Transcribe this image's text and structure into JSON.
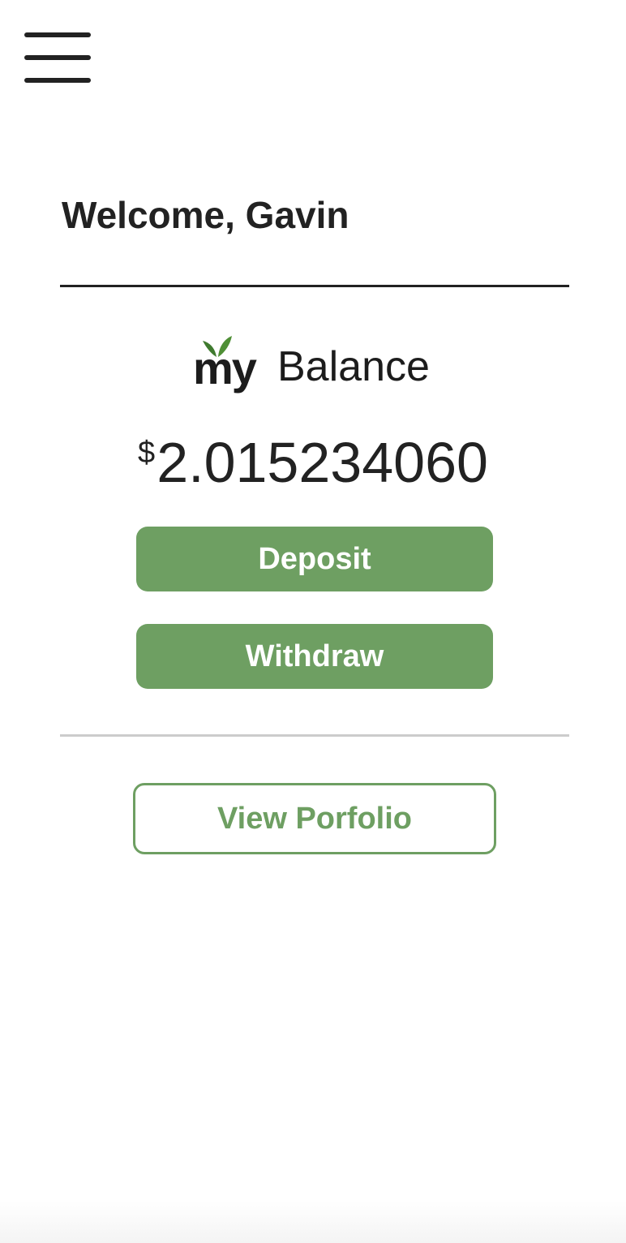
{
  "header": {
    "menu_icon": "hamburger-menu-icon"
  },
  "greeting": {
    "text": "Welcome, Gavin"
  },
  "logo": {
    "prefix": "my",
    "word": "Balance",
    "leaf_icon": "sprout-leaf-icon",
    "leaf_color": "#3f7a2e"
  },
  "balance": {
    "currency_symbol": "$",
    "amount": "2.015234060"
  },
  "actions": {
    "deposit_label": "Deposit",
    "withdraw_label": "Withdraw",
    "view_portfolio_label": "View Porfolio"
  },
  "colors": {
    "accent": "#6e9f62",
    "text": "#222222",
    "divider_light": "#cccccc"
  }
}
